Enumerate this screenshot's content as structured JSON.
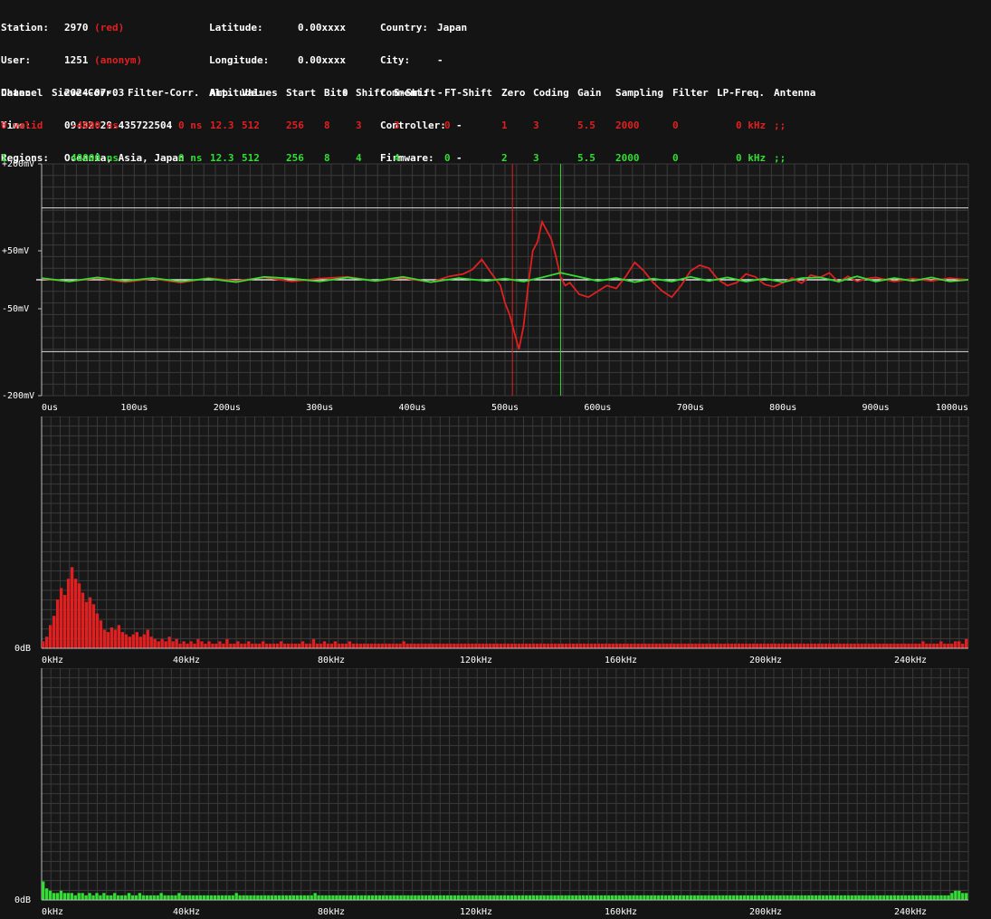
{
  "info": {
    "col1": [
      {
        "label": "Station:",
        "value": "2970",
        "extra": "(red)"
      },
      {
        "label": "User:",
        "value": "1251",
        "extra": "(anonym)"
      },
      {
        "label": "Date:",
        "value": "2024-07-03",
        "extra": ""
      },
      {
        "label": "Time:",
        "value": "09:32:29.435722504",
        "extra": ""
      },
      {
        "label": "Regions:",
        "value": "Oceania, Asia, Japan",
        "extra": ""
      }
    ],
    "col2": [
      {
        "label": "Latitude:",
        "value": "0.00xxxx"
      },
      {
        "label": "Longitude:",
        "value": "0.00xxxx"
      },
      {
        "label": "Altitude:",
        "value": "0"
      }
    ],
    "col3": [
      {
        "label": "Country:",
        "value": "Japan"
      },
      {
        "label": "City:",
        "value": "-"
      },
      {
        "label": "Comment:",
        "value": "-"
      },
      {
        "label": "Controller:",
        "value": "-"
      },
      {
        "label": "Firmware:",
        "value": "-"
      }
    ]
  },
  "channels": {
    "headers": [
      "Channel",
      "Sieve-Corr.",
      "Filter-Corr.",
      "Amp.",
      "Values",
      "Start",
      "Bits",
      "Shift",
      "S-Shift",
      "FT-Shift",
      "Zero",
      "Coding",
      "Gain",
      "Sampling",
      "Filter",
      "LP-Freq.",
      "Antenna"
    ],
    "rows": [
      {
        "color": "#e02020",
        "cells": [
          "0 valid",
          "-4000 ns",
          "0 ns",
          "12.3",
          "512",
          "256",
          "8",
          "3",
          "3",
          "0",
          "1",
          "3",
          "5.5",
          "2000",
          "0",
          "0 kHz",
          ";;"
        ]
      },
      {
        "color": "#33dd33",
        "cells": [
          "1",
          "48000 ns",
          "0 ns",
          "12.3",
          "512",
          "256",
          "8",
          "4",
          "4",
          "0",
          "2",
          "3",
          "5.5",
          "2000",
          "0",
          "0 kHz",
          ";;"
        ]
      }
    ]
  },
  "colors": {
    "background": "#141414",
    "plot_background": "#181818",
    "grid": "#3a3a3a",
    "channel0": "#e02020",
    "channel1": "#33dd33",
    "text": "#ffffff"
  },
  "chart_data": [
    {
      "type": "line",
      "y_tick_labels": [
        "+200mV",
        "+50mV",
        "-50mV",
        "-200mV"
      ],
      "y_tick_values": [
        200,
        50,
        -50,
        -200
      ],
      "x_tick_labels": [
        "0us",
        "100us",
        "200us",
        "300us",
        "400us",
        "500us",
        "600us",
        "700us",
        "800us",
        "900us",
        "1000us"
      ],
      "xlim": [
        0,
        1000
      ],
      "ylim": [
        -200,
        200
      ],
      "threshold_lines_mV": [
        124,
        -124
      ],
      "markers_us": [
        {
          "x": 508,
          "color": "#e02020"
        },
        {
          "x": 560,
          "color": "#33dd33"
        }
      ],
      "series": [
        {
          "color": "#e02020",
          "x": [
            0,
            30,
            60,
            90,
            120,
            150,
            180,
            210,
            240,
            270,
            300,
            330,
            360,
            390,
            420,
            440,
            455,
            465,
            475,
            485,
            495,
            500,
            505,
            510,
            515,
            520,
            525,
            530,
            535,
            540,
            545,
            550,
            555,
            560,
            565,
            570,
            575,
            580,
            590,
            600,
            610,
            620,
            630,
            640,
            650,
            660,
            670,
            680,
            690,
            700,
            710,
            720,
            730,
            740,
            750,
            760,
            770,
            780,
            790,
            800,
            810,
            820,
            830,
            840,
            850,
            860,
            870,
            880,
            890,
            900,
            920,
            940,
            960,
            980,
            1000
          ],
          "y": [
            2,
            -3,
            3,
            -4,
            2,
            -5,
            3,
            -2,
            4,
            -3,
            2,
            5,
            -2,
            3,
            -4,
            6,
            10,
            18,
            35,
            12,
            -10,
            -40,
            -60,
            -90,
            -120,
            -80,
            -10,
            50,
            65,
            100,
            85,
            70,
            40,
            5,
            -10,
            -5,
            -15,
            -25,
            -30,
            -20,
            -10,
            -15,
            5,
            30,
            15,
            -5,
            -20,
            -30,
            -10,
            15,
            25,
            20,
            0,
            -10,
            -5,
            10,
            5,
            -8,
            -12,
            -5,
            3,
            -6,
            8,
            4,
            12,
            -4,
            6,
            -3,
            2,
            4,
            -3,
            2,
            -2,
            3,
            0
          ]
        },
        {
          "color": "#33dd33",
          "x": [
            0,
            30,
            60,
            90,
            120,
            150,
            180,
            210,
            240,
            270,
            300,
            330,
            360,
            390,
            420,
            450,
            480,
            500,
            520,
            540,
            560,
            580,
            600,
            620,
            640,
            660,
            680,
            700,
            720,
            740,
            760,
            780,
            800,
            820,
            840,
            860,
            880,
            900,
            920,
            940,
            960,
            980,
            1000
          ],
          "y": [
            3,
            -3,
            4,
            -2,
            3,
            -3,
            2,
            -4,
            5,
            2,
            -3,
            4,
            -2,
            5,
            -4,
            3,
            -2,
            2,
            -3,
            4,
            12,
            5,
            -2,
            3,
            -4,
            2,
            -3,
            5,
            -2,
            4,
            -3,
            2,
            -4,
            3,
            4,
            -3,
            6,
            -3,
            3,
            -2,
            4,
            -3,
            0
          ]
        }
      ]
    },
    {
      "type": "bar",
      "x_tick_labels": [
        "0kHz",
        "40kHz",
        "80kHz",
        "120kHz",
        "160kHz",
        "200kHz",
        "240kHz"
      ],
      "y_label": "0dB",
      "color": "#e02020",
      "values": [
        3,
        5,
        10,
        14,
        21,
        26,
        23,
        30,
        35,
        30,
        28,
        24,
        20,
        22,
        19,
        15,
        12,
        8,
        7,
        9,
        8,
        10,
        7,
        6,
        5,
        6,
        7,
        5,
        6,
        8,
        5,
        4,
        3,
        4,
        3,
        5,
        3,
        4,
        2,
        3,
        2,
        3,
        2,
        4,
        3,
        2,
        3,
        2,
        2,
        3,
        2,
        4,
        2,
        2,
        3,
        2,
        2,
        3,
        2,
        2,
        2,
        3,
        2,
        2,
        2,
        2,
        3,
        2,
        2,
        2,
        2,
        2,
        3,
        2,
        2,
        4,
        2,
        2,
        3,
        2,
        2,
        3,
        2,
        2,
        2,
        3,
        2,
        2,
        2,
        2,
        2,
        2,
        2,
        2,
        2,
        2,
        2,
        2,
        2,
        2,
        3,
        2,
        2,
        2,
        2,
        2,
        2,
        2,
        2,
        2,
        2,
        2,
        2,
        2,
        2,
        2,
        2,
        2,
        2,
        2,
        2,
        2,
        2,
        2,
        2,
        2,
        2,
        2,
        2,
        2,
        2,
        2,
        2,
        2,
        2,
        2,
        2,
        2,
        2,
        2,
        2,
        2,
        2,
        2,
        2,
        2,
        2,
        2,
        2,
        2,
        2,
        2,
        2,
        2,
        2,
        2,
        2,
        2,
        2,
        2,
        2,
        2,
        2,
        2,
        2,
        2,
        2,
        2,
        2,
        2,
        2,
        2,
        2,
        2,
        2,
        2,
        2,
        2,
        2,
        2,
        2,
        2,
        2,
        2,
        2,
        2,
        2,
        2,
        2,
        2,
        2,
        2,
        2,
        2,
        2,
        2,
        2,
        2,
        2,
        2,
        2,
        2,
        2,
        2,
        2,
        2,
        2,
        2,
        2,
        2,
        2,
        2,
        2,
        2,
        2,
        2,
        2,
        2,
        2,
        2,
        2,
        2,
        2,
        2,
        2,
        2,
        2,
        2,
        2,
        2,
        2,
        2,
        2,
        2,
        2,
        2,
        2,
        2,
        2,
        2,
        2,
        2,
        2,
        2,
        3,
        2,
        2,
        2,
        2,
        3,
        2,
        2,
        2,
        3,
        3,
        2,
        4
      ],
      "ylim": [
        0,
        100
      ]
    },
    {
      "type": "bar",
      "x_tick_labels": [
        "0kHz",
        "40kHz",
        "80kHz",
        "120kHz",
        "160kHz",
        "200kHz",
        "240kHz"
      ],
      "y_label": "0dB",
      "color": "#33dd33",
      "values": [
        8,
        5,
        4,
        3,
        3,
        4,
        3,
        3,
        3,
        2,
        3,
        3,
        2,
        3,
        2,
        3,
        2,
        3,
        2,
        2,
        3,
        2,
        2,
        2,
        3,
        2,
        2,
        3,
        2,
        2,
        2,
        2,
        2,
        3,
        2,
        2,
        2,
        2,
        3,
        2,
        2,
        2,
        2,
        2,
        2,
        2,
        2,
        2,
        2,
        2,
        2,
        2,
        2,
        2,
        3,
        2,
        2,
        2,
        2,
        2,
        2,
        2,
        2,
        2,
        2,
        2,
        2,
        2,
        2,
        2,
        2,
        2,
        2,
        2,
        2,
        2,
        3,
        2,
        2,
        2,
        2,
        2,
        2,
        2,
        2,
        2,
        2,
        2,
        2,
        2,
        2,
        2,
        2,
        2,
        2,
        2,
        2,
        2,
        2,
        2,
        2,
        2,
        2,
        2,
        2,
        2,
        2,
        2,
        2,
        2,
        2,
        2,
        2,
        2,
        2,
        2,
        2,
        2,
        2,
        2,
        2,
        2,
        2,
        2,
        2,
        2,
        2,
        2,
        2,
        2,
        2,
        2,
        2,
        2,
        2,
        2,
        2,
        2,
        2,
        2,
        2,
        2,
        2,
        2,
        2,
        2,
        2,
        2,
        2,
        2,
        2,
        2,
        2,
        2,
        2,
        2,
        2,
        2,
        2,
        2,
        2,
        2,
        2,
        2,
        2,
        2,
        2,
        2,
        2,
        2,
        2,
        2,
        2,
        2,
        2,
        2,
        2,
        2,
        2,
        2,
        2,
        2,
        2,
        2,
        2,
        2,
        2,
        2,
        2,
        2,
        2,
        2,
        2,
        2,
        2,
        2,
        2,
        2,
        2,
        2,
        2,
        2,
        2,
        2,
        2,
        2,
        2,
        2,
        2,
        2,
        2,
        2,
        2,
        2,
        2,
        2,
        2,
        2,
        2,
        2,
        2,
        2,
        2,
        2,
        2,
        2,
        2,
        2,
        2,
        2,
        2,
        2,
        2,
        2,
        2,
        2,
        2,
        2,
        2,
        2,
        2,
        2,
        2,
        2,
        2,
        2,
        2,
        2,
        2,
        2,
        2,
        2,
        2,
        2,
        3,
        4,
        4,
        3,
        3
      ],
      "ylim": [
        0,
        100
      ]
    }
  ]
}
